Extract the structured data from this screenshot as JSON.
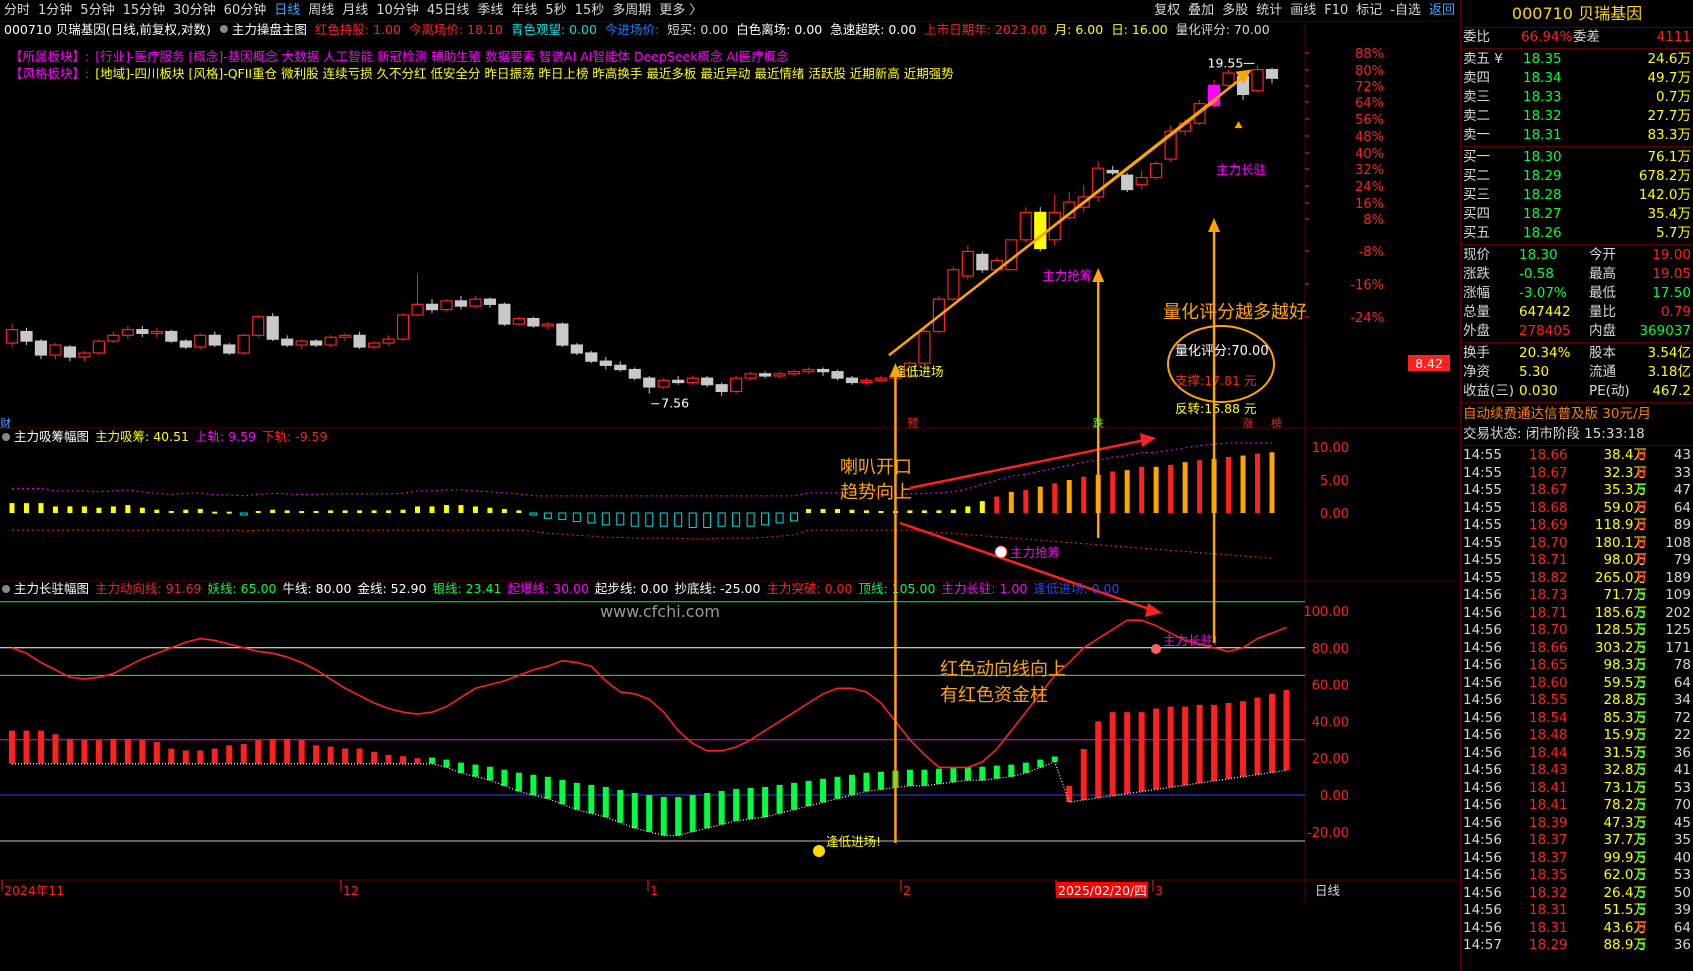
{
  "toolbar": {
    "periods": [
      "分时",
      "1分钟",
      "5分钟",
      "15分钟",
      "30分钟",
      "60分钟",
      "日线",
      "周线",
      "月线",
      "10分钟",
      "45日线",
      "季线",
      "年线",
      "5秒",
      "15秒",
      "多周期",
      "更多 〉"
    ],
    "selected_period": "日线",
    "tools": [
      "复权",
      "叠加",
      "多股",
      "统计",
      "画线",
      "F10",
      "标记",
      "-自选",
      "返回"
    ]
  },
  "colors": {
    "up": "#ff2020",
    "down_candle": "#c8c8c8",
    "green": "#00ff40",
    "cyan": "#00e0e0",
    "yellow": "#ffff00",
    "magenta": "#ff00ff",
    "orange": "#ffa500",
    "grid": "#5a0000",
    "blue": "#3040ff"
  },
  "main_header": [
    {
      "t": "000710 贝瑞基因(日线,前复权,对数)",
      "c": "#ffffff"
    },
    {
      "t": "主力操盘主图",
      "c": "#ffffff"
    },
    {
      "t": "红色持股: 1.00",
      "c": "#ff2020"
    },
    {
      "t": "今离场价: 18.10",
      "c": "#ff2020"
    },
    {
      "t": "青色观望: 0.00",
      "c": "#00e0e0"
    },
    {
      "t": "今进场价:",
      "c": "#1080ff"
    },
    {
      "t": "短买: 0.00",
      "c": "#d8d8d8"
    },
    {
      "t": "白色离场: 0.00",
      "c": "#ffffff"
    },
    {
      "t": "急速超跌: 0.00",
      "c": "#ffffff"
    },
    {
      "t": "上市日期年: 2023.00",
      "c": "#ff2020"
    },
    {
      "t": "月: 6.00",
      "c": "#ffff00"
    },
    {
      "t": "日: 16.00",
      "c": "#ffff00"
    },
    {
      "t": "量化评分: 70.00",
      "c": "#d8d8d8"
    }
  ],
  "sector_rows": [
    {
      "label": "【所属板块】:",
      "text": "[行业]-医疗服务 [概念]-基因概念 大数据 人工智能 新冠检测 辅助生殖 数据要素 智谱AI AI智能体 DeepSeek概念 AI医疗概念",
      "color": "#ff00ff"
    },
    {
      "label": "【风格板块】:",
      "text": "[地域]-四川板块 [风格]-QFII重仓 微利股 连续亏损 久不分红 低安全分 昨日振荡 昨日上榜 昨高换手 最近多板 最近异动 最近情绪 活跃股 近期新高 近期强势",
      "color": "#ffff00"
    }
  ],
  "price_axis": [
    "88%",
    "80%",
    "72%",
    "64%",
    "56%",
    "48%",
    "40%",
    "32%",
    "24%",
    "16%",
    "8%",
    "-8%",
    "-16%",
    "-24%"
  ],
  "price_chart": {
    "high_label": "19.55",
    "low_label": "7.56",
    "current_price_tag": "8.42",
    "candles": [
      [
        8.4,
        8.75,
        8.3,
        8.9
      ],
      [
        8.7,
        8.45,
        8.35,
        8.8
      ],
      [
        8.45,
        8.1,
        8.0,
        8.5
      ],
      [
        8.1,
        8.35,
        8.0,
        8.4
      ],
      [
        8.3,
        8.05,
        7.95,
        8.35
      ],
      [
        8.05,
        8.15,
        7.95,
        8.2
      ],
      [
        8.15,
        8.45,
        8.1,
        8.5
      ],
      [
        8.45,
        8.6,
        8.4,
        8.7
      ],
      [
        8.6,
        8.75,
        8.5,
        8.85
      ],
      [
        8.75,
        8.65,
        8.55,
        8.85
      ],
      [
        8.65,
        8.7,
        8.55,
        8.8
      ],
      [
        8.7,
        8.45,
        8.4,
        8.75
      ],
      [
        8.45,
        8.3,
        8.25,
        8.5
      ],
      [
        8.3,
        8.6,
        8.25,
        8.65
      ],
      [
        8.6,
        8.35,
        8.3,
        8.7
      ],
      [
        8.35,
        8.15,
        8.1,
        8.4
      ],
      [
        8.15,
        8.6,
        8.1,
        8.65
      ],
      [
        8.6,
        9.1,
        8.55,
        9.15
      ],
      [
        9.1,
        8.5,
        8.45,
        9.2
      ],
      [
        8.5,
        8.35,
        8.3,
        8.6
      ],
      [
        8.35,
        8.45,
        8.25,
        8.5
      ],
      [
        8.45,
        8.35,
        8.3,
        8.5
      ],
      [
        8.35,
        8.55,
        8.3,
        8.6
      ],
      [
        8.55,
        8.6,
        8.45,
        8.65
      ],
      [
        8.6,
        8.3,
        8.25,
        8.7
      ],
      [
        8.3,
        8.4,
        8.25,
        8.45
      ],
      [
        8.4,
        8.5,
        8.35,
        8.6
      ],
      [
        8.5,
        9.15,
        8.45,
        9.2
      ],
      [
        9.15,
        9.45,
        9.1,
        10.35
      ],
      [
        9.45,
        9.3,
        9.2,
        9.6
      ],
      [
        9.3,
        9.55,
        9.25,
        9.6
      ],
      [
        9.55,
        9.4,
        9.3,
        9.7
      ],
      [
        9.4,
        9.6,
        9.35,
        9.7
      ],
      [
        9.6,
        9.45,
        9.35,
        9.65
      ],
      [
        9.45,
        8.9,
        8.85,
        9.5
      ],
      [
        8.9,
        9.05,
        8.85,
        9.1
      ],
      [
        9.05,
        8.85,
        8.8,
        9.1
      ],
      [
        8.85,
        8.9,
        8.75,
        8.95
      ],
      [
        8.9,
        8.35,
        8.3,
        8.95
      ],
      [
        8.35,
        8.15,
        8.1,
        8.4
      ],
      [
        8.15,
        7.95,
        7.9,
        8.2
      ],
      [
        7.95,
        7.85,
        7.75,
        8.05
      ],
      [
        7.85,
        7.75,
        7.7,
        7.95
      ],
      [
        7.75,
        7.55,
        7.5,
        7.8
      ],
      [
        7.55,
        7.35,
        7.2,
        7.6
      ],
      [
        7.35,
        7.5,
        7.3,
        7.55
      ],
      [
        7.5,
        7.45,
        7.4,
        7.6
      ],
      [
        7.45,
        7.55,
        7.4,
        7.6
      ],
      [
        7.55,
        7.4,
        7.35,
        7.6
      ],
      [
        7.4,
        7.25,
        7.15,
        7.45
      ],
      [
        7.25,
        7.55,
        7.2,
        7.6
      ],
      [
        7.55,
        7.65,
        7.5,
        7.7
      ],
      [
        7.65,
        7.6,
        7.55,
        7.7
      ],
      [
        7.6,
        7.65,
        7.55,
        7.7
      ],
      [
        7.65,
        7.7,
        7.6,
        7.75
      ],
      [
        7.7,
        7.75,
        7.65,
        7.8
      ],
      [
        7.75,
        7.7,
        7.6,
        7.8
      ],
      [
        7.7,
        7.55,
        7.5,
        7.75
      ],
      [
        7.55,
        7.45,
        7.4,
        7.6
      ],
      [
        7.45,
        7.5,
        7.4,
        7.55
      ],
      [
        7.5,
        7.55,
        7.45,
        7.6
      ],
      [
        7.55,
        7.6,
        7.5,
        7.65
      ],
      [
        7.6,
        7.9,
        7.55,
        7.95
      ],
      [
        7.9,
        8.7,
        7.85,
        8.75
      ],
      [
        8.7,
        9.6,
        8.65,
        9.7
      ],
      [
        9.6,
        10.5,
        9.55,
        10.6
      ],
      [
        10.3,
        11.1,
        10.2,
        11.3
      ],
      [
        11.0,
        10.5,
        10.4,
        11.1
      ],
      [
        10.5,
        10.8,
        10.4,
        10.9
      ],
      [
        10.5,
        11.5,
        10.5,
        11.5
      ],
      [
        11.5,
        12.5,
        11.4,
        12.7
      ],
      [
        12.5,
        11.2,
        11.1,
        12.7
      ],
      [
        11.5,
        12.5,
        11.3,
        13.2
      ],
      [
        12.3,
        12.9,
        12.2,
        13.3
      ],
      [
        12.7,
        13.1,
        12.5,
        13.6
      ],
      [
        13.1,
        14.3,
        12.9,
        14.6
      ],
      [
        14.2,
        14.1,
        14.0,
        14.4
      ],
      [
        14.0,
        13.4,
        13.3,
        14.1
      ],
      [
        13.6,
        13.9,
        13.4,
        14.2
      ],
      [
        13.9,
        14.5,
        13.8,
        14.6
      ],
      [
        14.7,
        16.0,
        14.6,
        16.3
      ],
      [
        16.0,
        16.4,
        15.8,
        16.6
      ],
      [
        16.4,
        17.4,
        16.3,
        17.6
      ],
      [
        17.3,
        18.4,
        17.2,
        18.7
      ],
      [
        18.4,
        19.1,
        18.2,
        19.3
      ],
      [
        18.9,
        17.9,
        17.6,
        19.2
      ],
      [
        18.1,
        19.3,
        18.0,
        19.55
      ],
      [
        19.3,
        18.8,
        18.5,
        19.4
      ]
    ]
  },
  "price_annotations": [
    {
      "t": "逢低进场",
      "c": "#ffff00"
    },
    {
      "t": "主力抢筹",
      "c": "#ff00ff"
    },
    {
      "t": "主力长驻",
      "c": "#ff00ff"
    },
    {
      "t": "量化评分越多越好",
      "c": "#ffa500"
    },
    {
      "t": "量化评分:70.00",
      "c": "#ffffff"
    },
    {
      "t": "支撑:17.81 元",
      "c": "#ff2020"
    },
    {
      "t": "反转:16.88 元",
      "c": "#ffff00"
    },
    {
      "t": "预",
      "c": "#ff2020"
    },
    {
      "t": "跌",
      "c": "#00ff40"
    },
    {
      "t": "涨",
      "c": "#ff2020"
    },
    {
      "t": "榜",
      "c": "#ff2020"
    },
    {
      "t": "财",
      "c": "#40a0ff"
    }
  ],
  "ind1": {
    "header": [
      {
        "t": "主力吸筹幅图",
        "c": "#ffffff"
      },
      {
        "t": "主力吸筹: 40.51",
        "c": "#ffff00"
      },
      {
        "t": "上轨: 9.59",
        "c": "#ff00ff"
      },
      {
        "t": "下轨: -9.59",
        "c": "#ff2020"
      }
    ],
    "axis": [
      "10.00",
      "5.00",
      "0.00"
    ],
    "annotation_text": "喇叭开口",
    "annotation_text2": "趋势向上",
    "mark": "主力抢筹",
    "bars": [
      1.5,
      1.5,
      1.5,
      1.0,
      1.0,
      1.0,
      0.8,
      1.0,
      1.2,
      0.8,
      0.5,
      0.3,
      0.5,
      0.6,
      0.2,
      0.2,
      -0.2,
      0.3,
      0.5,
      0.4,
      0.3,
      0.3,
      0.4,
      0.4,
      0.4,
      0.4,
      0.4,
      0.5,
      1.0,
      1.0,
      1.2,
      1.2,
      1.0,
      0.8,
      0.6,
      0.4,
      -0.3,
      -0.8,
      -1.0,
      -1.3,
      -1.5,
      -1.8,
      -1.8,
      -2.0,
      -2.0,
      -2.0,
      -2.0,
      -2.2,
      -2.2,
      -2.0,
      -2.0,
      -2.0,
      -1.8,
      -1.5,
      -1.2,
      0.6,
      0.6,
      0.6,
      0.5,
      0.4,
      0.3,
      0.3,
      0.4,
      0.4,
      0.4,
      0.5,
      1.0,
      1.8,
      2.5,
      3.2,
      3.5,
      4.0,
      4.5,
      5.0,
      5.5,
      5.8,
      6.3,
      6.5,
      7.0,
      7.0,
      7.3,
      7.7,
      8.0,
      8.2,
      8.5,
      8.7,
      9.0,
      9.2
    ]
  },
  "ind2": {
    "header": [
      {
        "t": "主力长驻幅图",
        "c": "#ffffff"
      },
      {
        "t": "主力动向线: 91.69",
        "c": "#ff2020"
      },
      {
        "t": "妖线: 65.00",
        "c": "#00ff40"
      },
      {
        "t": "牛线: 80.00",
        "c": "#ffffff"
      },
      {
        "t": "金线: 52.90",
        "c": "#ffffff"
      },
      {
        "t": "银线: 23.41",
        "c": "#00ff40"
      },
      {
        "t": "起爆线: 30.00",
        "c": "#ff00ff"
      },
      {
        "t": "起步线: 0.00",
        "c": "#ffffff"
      },
      {
        "t": "抄底线: -25.00",
        "c": "#ffffff"
      },
      {
        "t": "主力突破: 0.00",
        "c": "#ff2020"
      },
      {
        "t": "顶线: 105.00",
        "c": "#00ff40"
      },
      {
        "t": "主力长驻: 1.00",
        "c": "#ff00ff"
      },
      {
        "t": "逢低进场: 0.00",
        "c": "#3040ff"
      }
    ],
    "axis": [
      "100.00",
      "80.00",
      "60.00",
      "40.00",
      "20.00",
      "0.00",
      "-20.00"
    ],
    "watermark": "www.cfchi.com",
    "annotation_text": "红色动向线向上",
    "annotation_text2": "有红色资金柱",
    "mark_entry": "逢低进场!",
    "mark_stay": "主力长驻!",
    "line": [
      80,
      77,
      72,
      68,
      64,
      63,
      64,
      66,
      70,
      74,
      77,
      80,
      83,
      85,
      84,
      82,
      80,
      78,
      77,
      75,
      72,
      68,
      63,
      58,
      54,
      50,
      47,
      45,
      44,
      45,
      48,
      53,
      58,
      60,
      62,
      65,
      68,
      70,
      73,
      72,
      70,
      62,
      56,
      55,
      52,
      45,
      35,
      28,
      24,
      24,
      26,
      30,
      35,
      40,
      45,
      50,
      55,
      58,
      58,
      56,
      50,
      40,
      30,
      22,
      15,
      15,
      15,
      18,
      25,
      35,
      45,
      55,
      65,
      72,
      80,
      85,
      90,
      95,
      95,
      92,
      88,
      84,
      82,
      80,
      78,
      80,
      85,
      88,
      91
    ],
    "hist": [
      35,
      35,
      35,
      33,
      30,
      28,
      28,
      30,
      30,
      28,
      25,
      15,
      12,
      12,
      15,
      20,
      22,
      28,
      30,
      30,
      28,
      20,
      18,
      15,
      15,
      10,
      5,
      3,
      0,
      -3,
      -5,
      -8,
      -10,
      -12,
      -15,
      -18,
      -20,
      -22,
      -25,
      -28,
      -30,
      -32,
      -35,
      -38,
      -40,
      -42,
      -42,
      -40,
      -38,
      -36,
      -34,
      -33,
      -32,
      -30,
      -28,
      -26,
      -24,
      -22,
      -20,
      -18,
      -17,
      -16,
      -15,
      -15,
      -14,
      -13,
      -12,
      -12,
      -11,
      -10,
      -8,
      -5,
      -2,
      0,
      20,
      35,
      40,
      40,
      40,
      42,
      43,
      43,
      44,
      44,
      45,
      46,
      48,
      50,
      52
    ]
  },
  "date_axis": [
    "2024年11",
    "12",
    "1",
    "2",
    "2025/02/20/四",
    "3"
  ],
  "corner_label": "日线",
  "side": {
    "stock": "000710 贝瑞基因",
    "wei_bi_label": "委比",
    "wei_bi": "66.94%",
    "wei_cha_label": "委差",
    "wei_cha": "4111",
    "asks": [
      [
        "卖五 ¥",
        "18.35",
        "24.6万"
      ],
      [
        "卖四",
        "18.34",
        "49.7万"
      ],
      [
        "卖三",
        "18.33",
        "0.7万"
      ],
      [
        "卖二",
        "18.32",
        "27.7万"
      ],
      [
        "卖一",
        "18.31",
        "83.3万"
      ]
    ],
    "bids": [
      [
        "买一",
        "18.30",
        "76.1万"
      ],
      [
        "买二",
        "18.29",
        "678.2万"
      ],
      [
        "买三",
        "18.28",
        "142.0万"
      ],
      [
        "买四",
        "18.27",
        "35.4万"
      ],
      [
        "买五",
        "18.26",
        "5.7万"
      ]
    ],
    "stats": [
      [
        "现价",
        "18.30",
        "今开",
        "19.00"
      ],
      [
        "涨跌",
        "-0.58",
        "最高",
        "19.05"
      ],
      [
        "涨幅",
        "-3.07%",
        "最低",
        "17.50"
      ],
      [
        "总量",
        "647442",
        "量比",
        "0.79"
      ],
      [
        "外盘",
        "278405",
        "内盘",
        "369037"
      ]
    ],
    "stats2": [
      [
        "换手",
        "20.34%",
        "股本",
        "3.54亿"
      ],
      [
        "净资",
        "5.30",
        "流通",
        "3.18亿"
      ],
      [
        "收益(三)",
        "0.030",
        "PE(动)",
        "467.2"
      ]
    ],
    "ad": "自动续费通达信普及版 30元/月",
    "state": "交易状态: 闭市阶段 15:33:18",
    "ticks": [
      [
        "14:55",
        "18.66",
        "38.4万",
        "B",
        "43"
      ],
      [
        "14:55",
        "18.67",
        "32.3万",
        "B",
        "33"
      ],
      [
        "14:55",
        "18.67",
        "35.3万",
        "S",
        "47"
      ],
      [
        "14:55",
        "18.68",
        "59.0万",
        "B",
        "64"
      ],
      [
        "14:55",
        "18.69",
        "118.9万",
        "B",
        "89"
      ],
      [
        "14:55",
        "18.70",
        "180.1万",
        "B",
        "108"
      ],
      [
        "14:55",
        "18.71",
        "98.0万",
        "B",
        "79"
      ],
      [
        "14:55",
        "18.82",
        "265.0万",
        "B",
        "189"
      ],
      [
        "14:56",
        "18.73",
        "71.7万",
        "S",
        "109"
      ],
      [
        "14:56",
        "18.71",
        "185.6万",
        "S",
        "202"
      ],
      [
        "14:56",
        "18.70",
        "128.5万",
        "S",
        "125"
      ],
      [
        "14:56",
        "18.66",
        "303.2万",
        "S",
        "171"
      ],
      [
        "14:56",
        "18.65",
        "98.3万",
        "S",
        "78"
      ],
      [
        "14:56",
        "18.60",
        "59.5万",
        "S",
        "64"
      ],
      [
        "14:56",
        "18.55",
        "28.8万",
        "S",
        "34"
      ],
      [
        "14:56",
        "18.54",
        "85.3万",
        "S",
        "72"
      ],
      [
        "14:56",
        "18.48",
        "15.9万",
        "S",
        "22"
      ],
      [
        "14:56",
        "18.44",
        "31.5万",
        "S",
        "36"
      ],
      [
        "14:56",
        "18.43",
        "32.8万",
        "S",
        "41"
      ],
      [
        "14:56",
        "18.41",
        "73.1万",
        "S",
        "53"
      ],
      [
        "14:56",
        "18.41",
        "78.2万",
        "S",
        "70"
      ],
      [
        "14:56",
        "18.39",
        "47.3万",
        "S",
        "45"
      ],
      [
        "14:56",
        "18.37",
        "37.7万",
        "S",
        "35"
      ],
      [
        "14:56",
        "18.37",
        "99.9万",
        "S",
        "40"
      ],
      [
        "14:56",
        "18.35",
        "62.0万",
        "S",
        "53"
      ],
      [
        "14:56",
        "18.32",
        "26.4万",
        "S",
        "50"
      ],
      [
        "14:56",
        "18.31",
        "51.5万",
        "S",
        "39"
      ],
      [
        "14:56",
        "18.31",
        "43.6万",
        "B",
        "64"
      ],
      [
        "14:57",
        "18.29",
        "88.9万",
        "S",
        "36"
      ]
    ]
  }
}
